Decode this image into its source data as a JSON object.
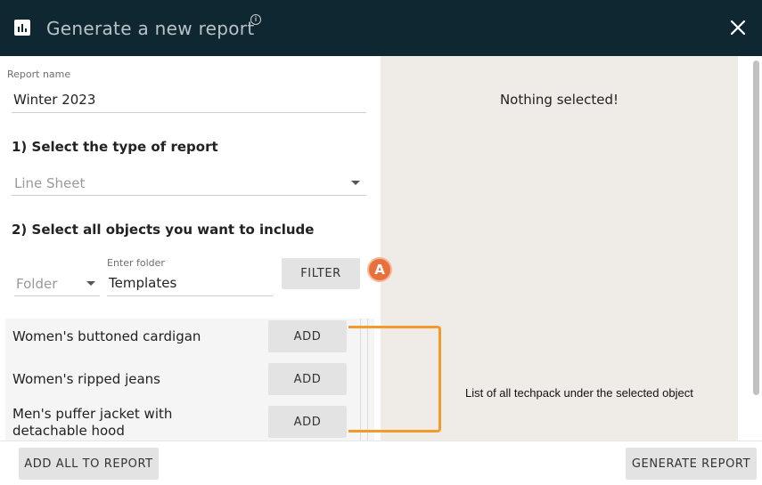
{
  "header": {
    "title": "Generate a new report",
    "info_glyph": "i",
    "icon": "bar-chart-icon"
  },
  "form": {
    "report_name_label": "Report name",
    "report_name_value": "Winter 2023",
    "step1_heading": "1) Select the type of report",
    "report_type_selected": "Line Sheet",
    "step2_heading": "2) Select all objects you want to include",
    "object_type_selected": "Folder",
    "folder_input_label": "Enter folder",
    "folder_input_value": "Templates",
    "filter_label": "FILTER"
  },
  "items": [
    {
      "name": "Women's buttoned cardigan",
      "action": "ADD"
    },
    {
      "name": "Women's ripped jeans",
      "action": "ADD"
    },
    {
      "name": "Men's puffer jacket with detachable hood",
      "action": "ADD"
    }
  ],
  "preview": {
    "empty_text": "Nothing selected!"
  },
  "annotations": {
    "marker": "A",
    "list_note": "List of all techpack under the selected object",
    "accent_color": "#f39a2d",
    "marker_color": "#e8703a"
  },
  "footer": {
    "add_all_label": "ADD ALL TO REPORT",
    "generate_label": "GENERATE REPORT"
  }
}
